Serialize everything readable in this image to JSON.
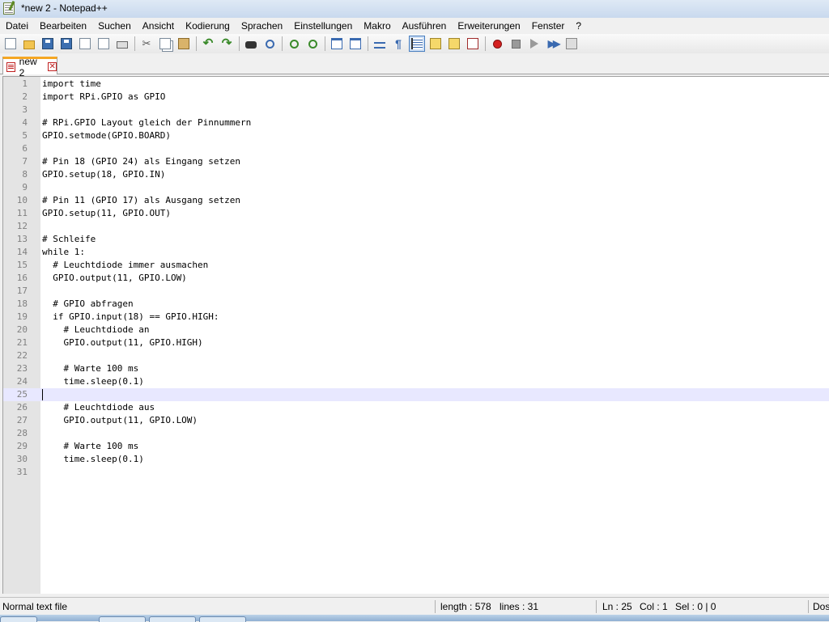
{
  "window": {
    "title": "*new 2 - Notepad++"
  },
  "menu": [
    "Datei",
    "Bearbeiten",
    "Suchen",
    "Ansicht",
    "Kodierung",
    "Sprachen",
    "Einstellungen",
    "Makro",
    "Ausführen",
    "Erweiterungen",
    "Fenster",
    "?"
  ],
  "toolbar": {
    "buttons": [
      {
        "name": "new-file-icon",
        "glyph": "g-doc"
      },
      {
        "name": "open-file-icon",
        "glyph": "g-folder"
      },
      {
        "name": "save-icon",
        "glyph": "g-disk"
      },
      {
        "name": "save-all-icon",
        "glyph": "g-disk"
      },
      {
        "name": "close-icon",
        "glyph": "g-doc"
      },
      {
        "name": "close-all-icon",
        "glyph": "g-doc"
      },
      {
        "name": "print-icon",
        "glyph": "g-print"
      },
      {
        "sep": true
      },
      {
        "name": "cut-icon",
        "glyph": "g-cut",
        "char": "✂"
      },
      {
        "name": "copy-icon",
        "glyph": "g-copy"
      },
      {
        "name": "paste-icon",
        "glyph": "g-paste"
      },
      {
        "sep": true
      },
      {
        "name": "undo-icon",
        "glyph": "g-arrow",
        "char": "↶"
      },
      {
        "name": "redo-icon",
        "glyph": "g-arrow",
        "char": "↷"
      },
      {
        "sep": true
      },
      {
        "name": "find-icon",
        "glyph": "g-bino"
      },
      {
        "name": "replace-icon",
        "glyph": "g-search"
      },
      {
        "sep": true
      },
      {
        "name": "zoom-in-icon",
        "glyph": "g-zoom"
      },
      {
        "name": "zoom-out-icon",
        "glyph": "g-zoom"
      },
      {
        "sep": true
      },
      {
        "name": "sync-vertical-icon",
        "glyph": "g-win"
      },
      {
        "name": "sync-horizontal-icon",
        "glyph": "g-win"
      },
      {
        "sep": true
      },
      {
        "name": "word-wrap-icon",
        "glyph": "g-wrap"
      },
      {
        "name": "show-all-characters-icon",
        "glyph": "g-para",
        "char": "¶"
      },
      {
        "name": "indent-guide-icon",
        "glyph": "g-indent",
        "active": true
      },
      {
        "name": "user-defined-language-icon",
        "glyph": "g-yellow"
      },
      {
        "name": "document-map-icon",
        "glyph": "g-yellow"
      },
      {
        "name": "function-list-icon",
        "glyph": "g-red"
      },
      {
        "sep": true
      },
      {
        "name": "record-macro-icon",
        "glyph": "g-rec"
      },
      {
        "name": "stop-recording-icon",
        "glyph": "g-stop"
      },
      {
        "name": "playback-macro-icon",
        "glyph": "g-play"
      },
      {
        "name": "run-macro-multiple-icon",
        "glyph": "g-ff",
        "char": "▶▶"
      },
      {
        "name": "save-macro-icon",
        "glyph": "g-save-macro"
      }
    ]
  },
  "tabs": [
    {
      "label": "new 2",
      "close": "✕"
    }
  ],
  "editor": {
    "current_line": 25,
    "lines": [
      "import time",
      "import RPi.GPIO as GPIO",
      "",
      "# RPi.GPIO Layout gleich der Pinnummern",
      "GPIO.setmode(GPIO.BOARD)",
      "",
      "# Pin 18 (GPIO 24) als Eingang setzen",
      "GPIO.setup(18, GPIO.IN)",
      "",
      "# Pin 11 (GPIO 17) als Ausgang setzen",
      "GPIO.setup(11, GPIO.OUT)",
      "",
      "# Schleife",
      "while 1:",
      "  # Leuchtdiode immer ausmachen",
      "  GPIO.output(11, GPIO.LOW)",
      "",
      "  # GPIO abfragen",
      "  if GPIO.input(18) == GPIO.HIGH:",
      "    # Leuchtdiode an",
      "    GPIO.output(11, GPIO.HIGH)",
      "",
      "    # Warte 100 ms",
      "    time.sleep(0.1)",
      "",
      "    # Leuchtdiode aus",
      "    GPIO.output(11, GPIO.LOW)",
      "",
      "    # Warte 100 ms",
      "    time.sleep(0.1)",
      ""
    ]
  },
  "status": {
    "file_type": "Normal text file",
    "length": "length : 578",
    "lines": "lines : 31",
    "ln": "Ln : 25",
    "col": "Col : 1",
    "sel": "Sel : 0 | 0",
    "eol": "Dos"
  }
}
